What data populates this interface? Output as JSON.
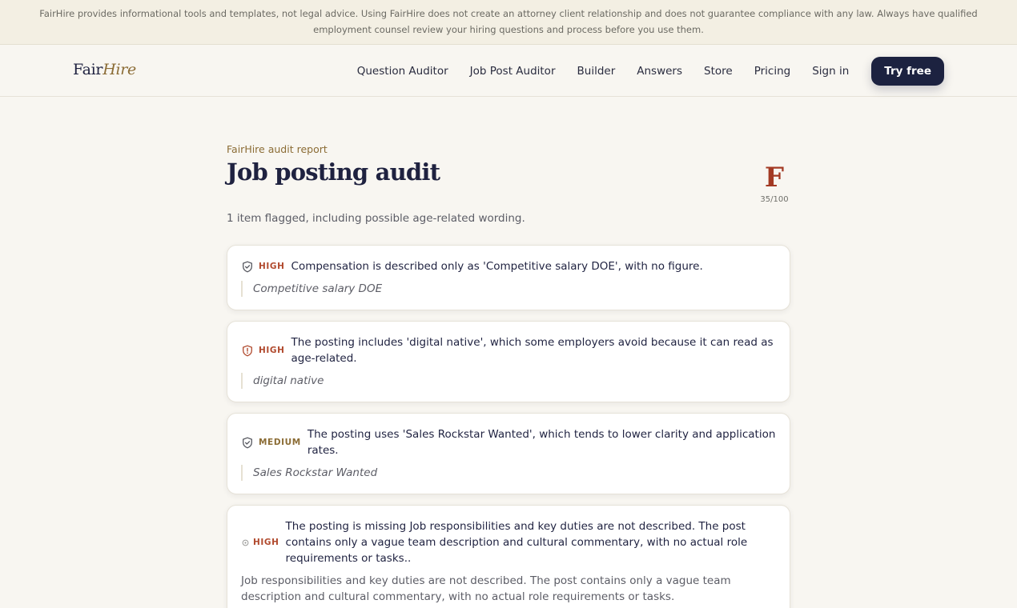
{
  "banner": {
    "text": "FairHire provides informational tools and templates, not legal advice. Using FairHire does not create an attorney client relationship and does not guarantee compliance with any law. Always have qualified employment counsel review your hiring questions and process before you use them."
  },
  "logo": {
    "part1": "Fair",
    "part2": "Hire"
  },
  "nav": {
    "items": [
      "Question Auditor",
      "Job Post Auditor",
      "Builder",
      "Answers",
      "Store",
      "Pricing",
      "Sign in"
    ],
    "cta": "Try free"
  },
  "report": {
    "eyebrow": "FairHire audit report",
    "title": "Job posting audit",
    "grade": "F",
    "score": "35/100",
    "summary": "1 item flagged, including possible age-related wording."
  },
  "findings": [
    {
      "icon": "shield-check-icon",
      "severity": "HIGH",
      "message": "Compensation is described only as 'Competitive salary DOE', with no figure.",
      "quote": "Competitive salary DOE"
    },
    {
      "icon": "shield-alert-icon",
      "severity": "HIGH",
      "message": "The posting includes 'digital native', which some employers avoid because it can read as age-related.",
      "quote": "digital native"
    },
    {
      "icon": "shield-check-icon",
      "severity": "MEDIUM",
      "message": "The posting uses 'Sales Rockstar Wanted', which tends to lower clarity and application rates.",
      "quote": "Sales Rockstar Wanted"
    },
    {
      "icon": "circle-dot-icon",
      "severity": "HIGH",
      "message": "The posting is missing Job responsibilities and key duties are not described. The post contains only a vague team description and cultural commentary, with no actual role requirements or tasks..",
      "detail": "Job responsibilities and key duties are not described. The post contains only a vague team description and cultural commentary, with no actual role requirements or tasks."
    }
  ],
  "colors": {
    "navy": "#1c2240",
    "gold": "#8b6c35",
    "grade_red": "#a33a24",
    "high": "#b14a2e",
    "background": "#f8f6f1"
  }
}
